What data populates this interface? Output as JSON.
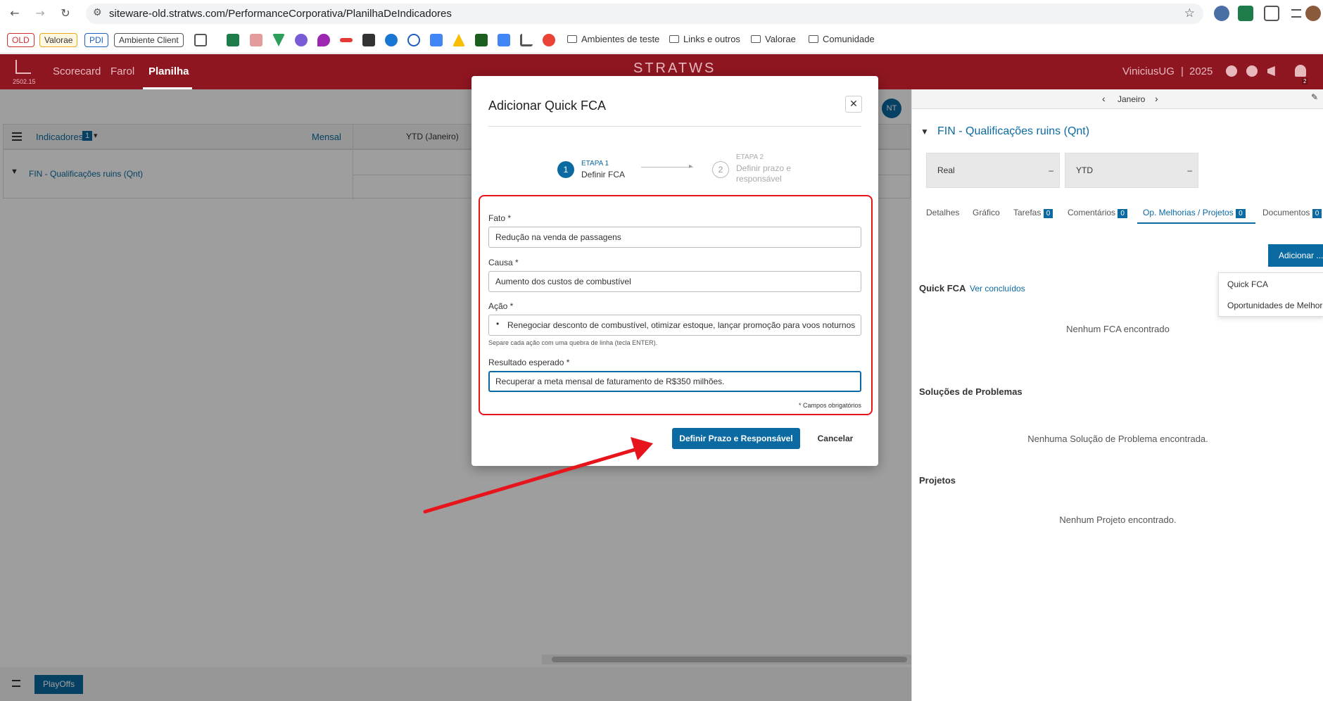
{
  "browser": {
    "url": "siteware-old.stratws.com/PerformanceCorporativa/PlanilhaDeIndicadores",
    "bookmarks": {
      "badges": [
        "OLD",
        "Valorae",
        "PDI",
        "Ambiente Client"
      ],
      "folders": [
        "Ambientes de teste",
        "Links e outros",
        "Valorae",
        "Comunidade"
      ]
    }
  },
  "app": {
    "logo_version": "2502.15",
    "nav": [
      "Scorecard",
      "Farol",
      "Planilha"
    ],
    "brand": "STRATWS",
    "user": "ViniciusUG",
    "year": "2025",
    "notif_count": "2",
    "avatar_initials": "NT"
  },
  "sheet": {
    "indicadores_label": "Indicadores",
    "indicadores_count": "1",
    "mensal": "Mensal",
    "ytd_col": "YTD (Janeiro)",
    "row_name": "FIN - Qualificações ruins (Qnt)"
  },
  "panel": {
    "month": "Janeiro",
    "title": "FIN - Qualificações ruins (Qnt)",
    "box_real": "Real",
    "box_ytd": "YTD",
    "box_dash": "–",
    "tabs": [
      {
        "label": "Detalhes",
        "count": ""
      },
      {
        "label": "Gráfico",
        "count": ""
      },
      {
        "label": "Tarefas",
        "count": "0"
      },
      {
        "label": "Comentários",
        "count": "0"
      },
      {
        "label": "Op. Melhorias / Projetos",
        "count": "0"
      },
      {
        "label": "Documentos",
        "count": "0"
      }
    ],
    "add_button": "Adicionar ...",
    "dropdown": [
      "Quick FCA",
      "Oportunidades de Melhoria"
    ],
    "quick_fca_title": "Quick FCA",
    "ver_concluidos": "Ver concluídos",
    "no_fca": "Nenhum FCA encontrado",
    "solucoes_title": "Soluções de Problemas",
    "no_solucoes": "Nenhuma Solução de Problema encontrada.",
    "projetos_title": "Projetos",
    "no_projetos": "Nenhum Projeto encontrado."
  },
  "bottom": {
    "playoffs": "PlayOffs"
  },
  "modal": {
    "title": "Adicionar Quick FCA",
    "step1_num": "1",
    "step1_label": "ETAPA 1",
    "step1_name": "Definir FCA",
    "step2_num": "2",
    "step2_label": "ETAPA 2",
    "step2_name_line1": "Definir prazo e",
    "step2_name_line2": "responsável",
    "fato_label": "Fato *",
    "fato_value": "Redução na venda de passagens",
    "causa_label": "Causa *",
    "causa_value": "Aumento dos custos de combustível",
    "acao_label": "Ação *",
    "acao_value": "Renegociar desconto de combustível, otimizar estoque, lançar promoção para voos noturnos",
    "acao_hint": "Separe cada ação com uma quebra de linha (tecla ENTER).",
    "resultado_label": "Resultado esperado *",
    "resultado_value": "Recuperar a meta mensal de faturamento de R$350 milhões.",
    "required_note": "* Campos obrigatórios",
    "primary_button": "Definir Prazo e Responsável",
    "cancel_button": "Cancelar"
  },
  "colors": {
    "app_header": "#8e1620",
    "primary": "#0b6aa1",
    "annotation_red": "#e8141b"
  }
}
